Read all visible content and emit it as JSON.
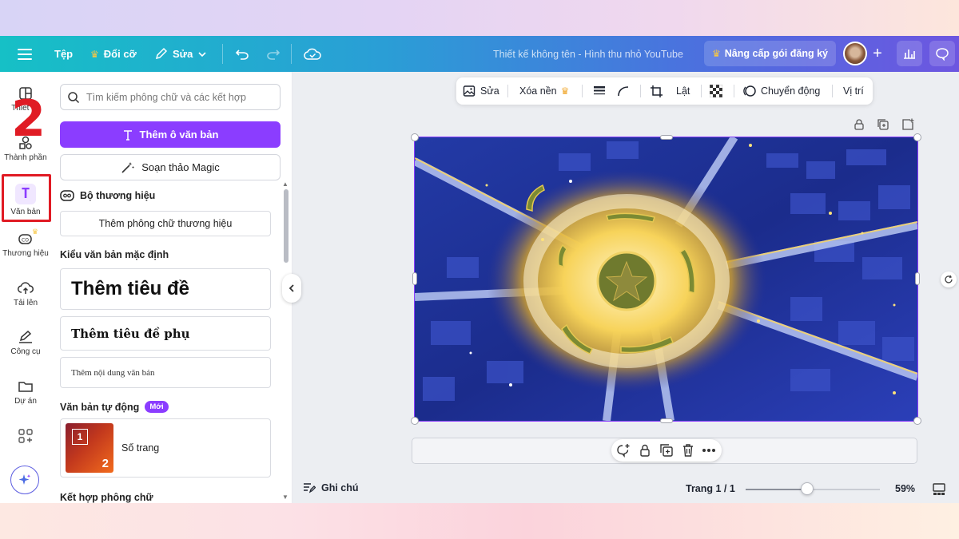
{
  "header": {
    "menu_icon": "hamburger-icon",
    "file_label": "Tệp",
    "resize_label": "Đổi cỡ",
    "edit_label": "Sửa",
    "design_title": "Thiết kế không tên - Hình thu nhỏ YouTube",
    "upgrade_label": "Nâng cấp gói đăng ký",
    "plus_label": "+"
  },
  "rail": {
    "annotation_number": "2",
    "items": [
      {
        "label": "Thiết kế",
        "icon": "layout-icon"
      },
      {
        "label": "Thành phần",
        "icon": "elements-icon"
      },
      {
        "label": "Văn bản",
        "icon": "text-icon"
      },
      {
        "label": "Thương hiệu",
        "icon": "brand-icon"
      },
      {
        "label": "Tải lên",
        "icon": "upload-cloud-icon"
      },
      {
        "label": "Công cụ",
        "icon": "tools-icon"
      },
      {
        "label": "Dự án",
        "icon": "folder-icon"
      },
      {
        "label": "",
        "icon": "apps-icon"
      }
    ]
  },
  "panel": {
    "search_placeholder": "Tìm kiếm phông chữ và các kết hợp",
    "add_textbox_label": "Thêm ô văn bản",
    "magic_write_label": "Soạn thảo Magic",
    "brand_kit_title": "Bộ thương hiệu",
    "add_brand_font_label": "Thêm phông chữ thương hiệu",
    "default_styles_title": "Kiểu văn bản mặc định",
    "heading_label": "Thêm tiêu đề",
    "subheading_label": "Thêm tiêu đề phụ",
    "body_label": "Thêm nội dung văn bản",
    "auto_text_title": "Văn bản tự động",
    "new_badge": "Mới",
    "page_number_label": "Số trang",
    "thumb_num_1": "1",
    "thumb_num_2": "2",
    "font_combo_title": "Kết hợp phông chữ"
  },
  "context_toolbar": {
    "edit_label": "Sửa",
    "bg_remove_label": "Xóa nền",
    "flip_label": "Lật",
    "animate_label": "Chuyển động",
    "position_label": "Vị trí"
  },
  "footer": {
    "notes_label": "Ghi chú",
    "page_indicator": "Trang 1 / 1",
    "zoom_label": "59%",
    "zoom_value": 59
  },
  "colors": {
    "accent": "#8b3dff",
    "annotation_red": "#e01b24"
  }
}
